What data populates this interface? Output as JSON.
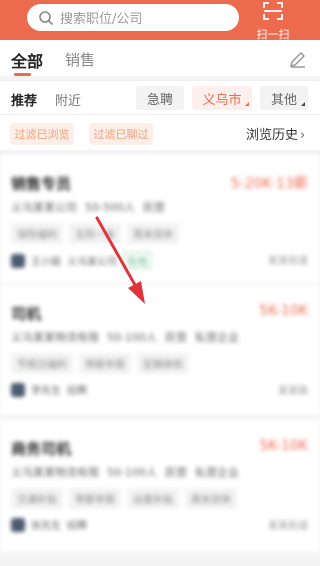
{
  "header": {
    "search_placeholder": "搜索职位/公司",
    "scan_label": "扫一扫",
    "accent_color": "#ec6a4d"
  },
  "tabs": [
    {
      "label": "全部",
      "active": true
    },
    {
      "label": "销售",
      "active": false
    }
  ],
  "filters": {
    "recommend": "推荐",
    "nearby": "附近",
    "chips": [
      "急聘",
      "义乌市",
      "其他"
    ]
  },
  "tagbar": {
    "chips": [
      "过滤已浏览",
      "过滤已聊过"
    ],
    "history": "浏览历史"
  },
  "jobs": [
    {
      "title": "销售专员",
      "salary": "5-20K·13薪",
      "details": [
        "义乌某某公司",
        "50-500人",
        "民营"
      ],
      "tags": [
        "保险福利",
        "五险一金",
        "周末双休"
      ],
      "recruiter": "王小姐",
      "company": "义乌某公司",
      "badge": "在线",
      "meta": "某某街道"
    },
    {
      "title": "司机",
      "salary": "5K-10K",
      "details": [
        "义乌某某物流有限",
        "50-100人",
        "民营",
        "私营企业"
      ],
      "tags": [
        "节假日福利",
        "带薪年假",
        "定期体检"
      ],
      "recruiter": "李先生",
      "company": "招聘",
      "badge": "",
      "meta": "某某路"
    },
    {
      "title": "商务司机",
      "salary": "5K-10K",
      "details": [
        "义乌某某物流有限",
        "50-100人",
        "民营",
        "私营企业"
      ],
      "tags": [
        "交通补贴",
        "带薪年假",
        "出差补贴",
        "周末双休"
      ],
      "recruiter": "张先生",
      "company": "招聘",
      "badge": "",
      "meta": "某某街道"
    }
  ]
}
